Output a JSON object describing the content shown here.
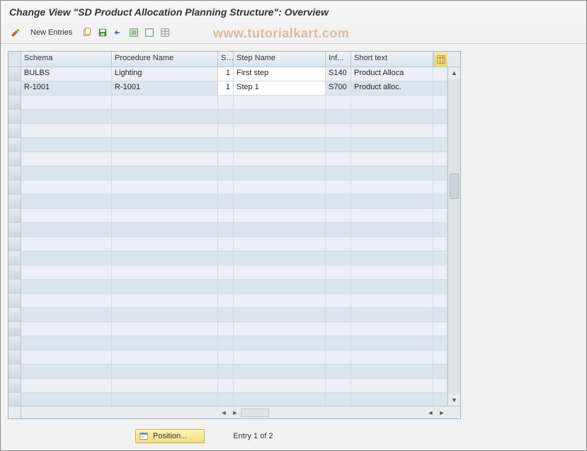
{
  "title": "Change View \"SD Product Allocation Planning Structure\": Overview",
  "watermark": "www.tutorialkart.com",
  "toolbar": {
    "new_entries_label": "New Entries"
  },
  "columns": {
    "schema": "Schema",
    "procedure_name": "Procedure Name",
    "s": "S..",
    "step_name": "Step Name",
    "inf": "Inf...",
    "short_text": "Short text"
  },
  "rows": [
    {
      "schema": "BULBS",
      "procedure_name": "Lighting",
      "s": "1",
      "step_name": "First step",
      "inf": "S140",
      "short_text": "Product Alloca"
    },
    {
      "schema": "R-1001",
      "procedure_name": "R-1001",
      "s": "1",
      "step_name": "Step 1",
      "inf": "S700",
      "short_text": "Product alloc."
    }
  ],
  "footer": {
    "position_label": "Position...",
    "entry_text": "Entry 1 of 2"
  }
}
